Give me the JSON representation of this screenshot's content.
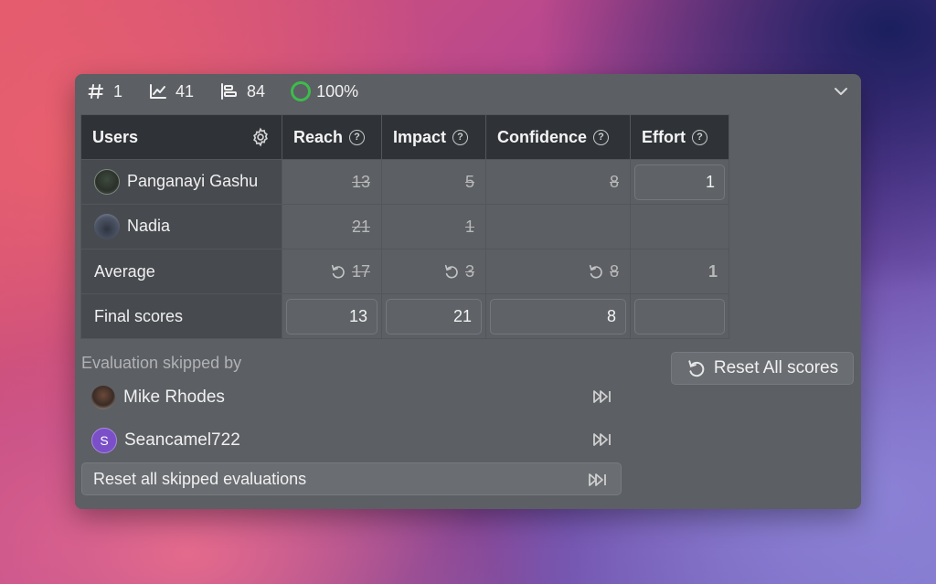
{
  "stats": {
    "id": "1",
    "trend": "41",
    "bars": "84",
    "progress": "100%",
    "progress_fraction": 1.0,
    "progress_color": "#3dbb4d"
  },
  "table": {
    "headers": {
      "users": "Users",
      "reach": "Reach",
      "impact": "Impact",
      "confidence": "Confidence",
      "effort": "Effort",
      "help": "?"
    },
    "rows": [
      {
        "name": "Panganayi Gashu",
        "reach": "13",
        "impact": "5",
        "confidence": "8",
        "effort": "1"
      },
      {
        "name": "Nadia",
        "reach": "21",
        "impact": "1",
        "confidence": "",
        "effort": ""
      }
    ],
    "average": {
      "label": "Average",
      "reach": "17",
      "impact": "3",
      "confidence": "8",
      "effort": "1"
    },
    "final": {
      "label": "Final scores",
      "reach": "13",
      "impact": "21",
      "confidence": "8",
      "effort": ""
    }
  },
  "skipped": {
    "title": "Evaluation skipped by",
    "users": [
      {
        "name": "Mike Rhodes",
        "icon": "skip-forward-icon"
      },
      {
        "name": "Seancamel722",
        "initial": "S",
        "icon": "skip-forward-icon"
      }
    ],
    "reset_label": "Reset all skipped evaluations"
  },
  "reset_all_label": "Reset All scores",
  "icons": {
    "id": "hash-icon",
    "trend": "line-chart-icon",
    "bars": "bar-list-icon",
    "collapse": "chevron-down-icon",
    "settings": "gear-icon",
    "undo": "undo-icon"
  }
}
